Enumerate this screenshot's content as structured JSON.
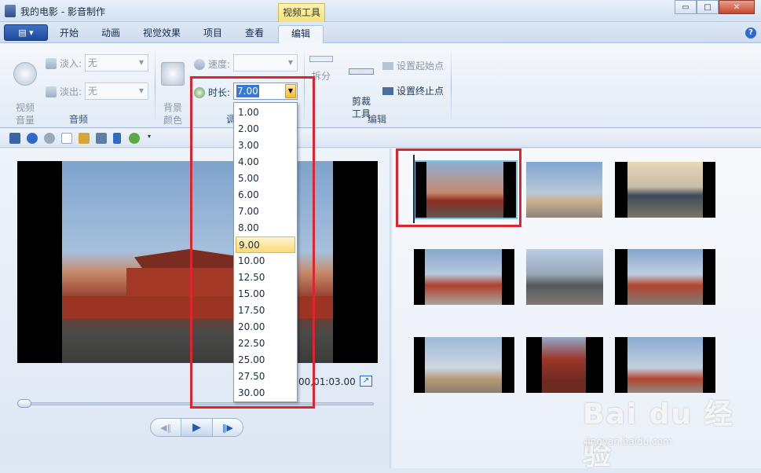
{
  "window": {
    "title": "我的电影 - 影音制作",
    "context_tab_label": "视频工具",
    "buttons": {
      "minimize": "▭",
      "maximize": "□",
      "close": "✕"
    }
  },
  "tabs": {
    "app_menu": "▤ ▾",
    "items": [
      "开始",
      "动画",
      "视觉效果",
      "项目",
      "查看",
      "编辑"
    ],
    "active": "编辑",
    "help": "?"
  },
  "ribbon": {
    "audio": {
      "video_volume": "视频\n音量",
      "fade_in_label": "淡入:",
      "fade_in_value": "无",
      "fade_out_label": "淡出:",
      "fade_out_value": "无",
      "group_label": "音频"
    },
    "adjust": {
      "bg_color": "背景\n颜色",
      "speed_label": "速度:",
      "speed_value": "",
      "duration_label": "时长:",
      "duration_value": "7.00",
      "group_label": "调整"
    },
    "edit": {
      "split": "拆分",
      "trim_tool": "剪裁\n工具",
      "set_start": "设置起始点",
      "set_end": "设置终止点",
      "group_label": "编辑"
    }
  },
  "duration_options": [
    "1.00",
    "2.00",
    "3.00",
    "4.00",
    "5.00",
    "6.00",
    "7.00",
    "8.00",
    "9.00",
    "10.00",
    "12.50",
    "15.00",
    "17.50",
    "20.00",
    "22.50",
    "25.00",
    "27.50",
    "30.00"
  ],
  "duration_hover": "9.00",
  "preview": {
    "time": "00,01:03.00",
    "expand_icon": "↗",
    "prev_frame": "◀‖",
    "play": "▶",
    "next_frame": "‖▶"
  },
  "watermark": {
    "brand": "Bai du 经验",
    "url": "jingyan.baidu.com"
  },
  "colors": {
    "annotation_red": "#e0242f",
    "selection": "#7ec3e8"
  }
}
